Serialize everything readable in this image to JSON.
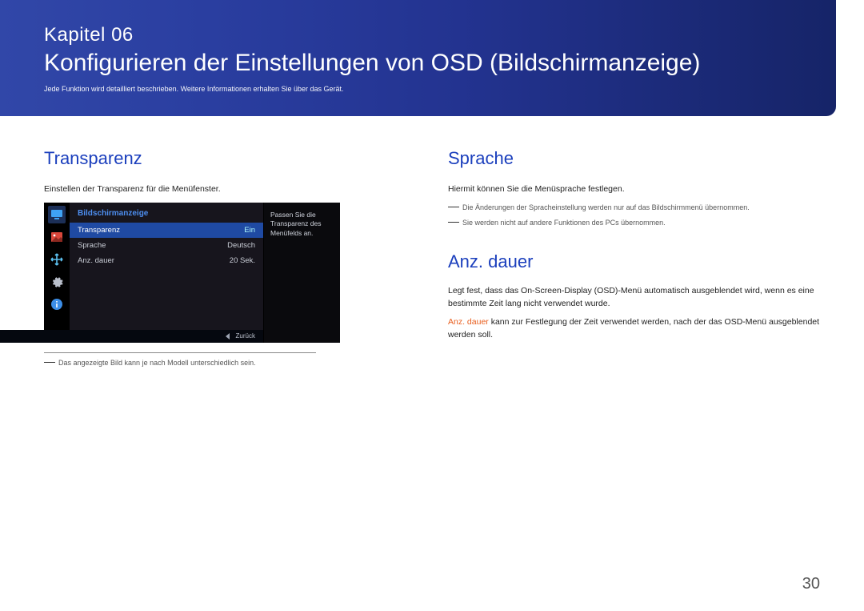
{
  "header": {
    "chapter_label": "Kapitel",
    "chapter_num": "06",
    "title": "Konfigurieren der Einstellungen von OSD (Bildschirmanzeige)",
    "subtitle": "Jede Funktion wird detailliert beschrieben. Weitere Informationen erhalten Sie über das Gerät."
  },
  "left": {
    "section": "Transparenz",
    "desc": "Einstellen der Transparenz für die Menüfenster.",
    "note": "Das angezeigte Bild kann je nach Modell unterschiedlich sein."
  },
  "osd": {
    "menu_title": "Bildschirmanzeige",
    "rows": [
      {
        "label": "Transparenz",
        "value": "Ein"
      },
      {
        "label": "Sprache",
        "value": "Deutsch"
      },
      {
        "label": "Anz. dauer",
        "value": "20 Sek."
      }
    ],
    "help": "Passen Sie die Transparenz des Menüfelds an.",
    "back": "Zurück"
  },
  "right": {
    "sections": [
      {
        "title": "Sprache",
        "p": "Hiermit können Sie die Menüsprache festlegen.",
        "notes": [
          "Die Änderungen der Spracheinstellung werden nur auf das Bildschirmmenü übernommen.",
          "Sie werden nicht auf andere Funktionen des PCs übernommen."
        ]
      },
      {
        "title": "Anz. dauer",
        "p": "Legt fest, dass das On-Screen-Display (OSD)-Menü automatisch ausgeblendet wird, wenn es eine bestimmte Zeit lang nicht verwendet wurde.",
        "hl_term": "Anz. dauer",
        "hl_rest": " kann zur Festlegung der Zeit verwendet werden, nach der das OSD-Menü ausgeblendet werden soll."
      }
    ]
  },
  "page_number": "30"
}
